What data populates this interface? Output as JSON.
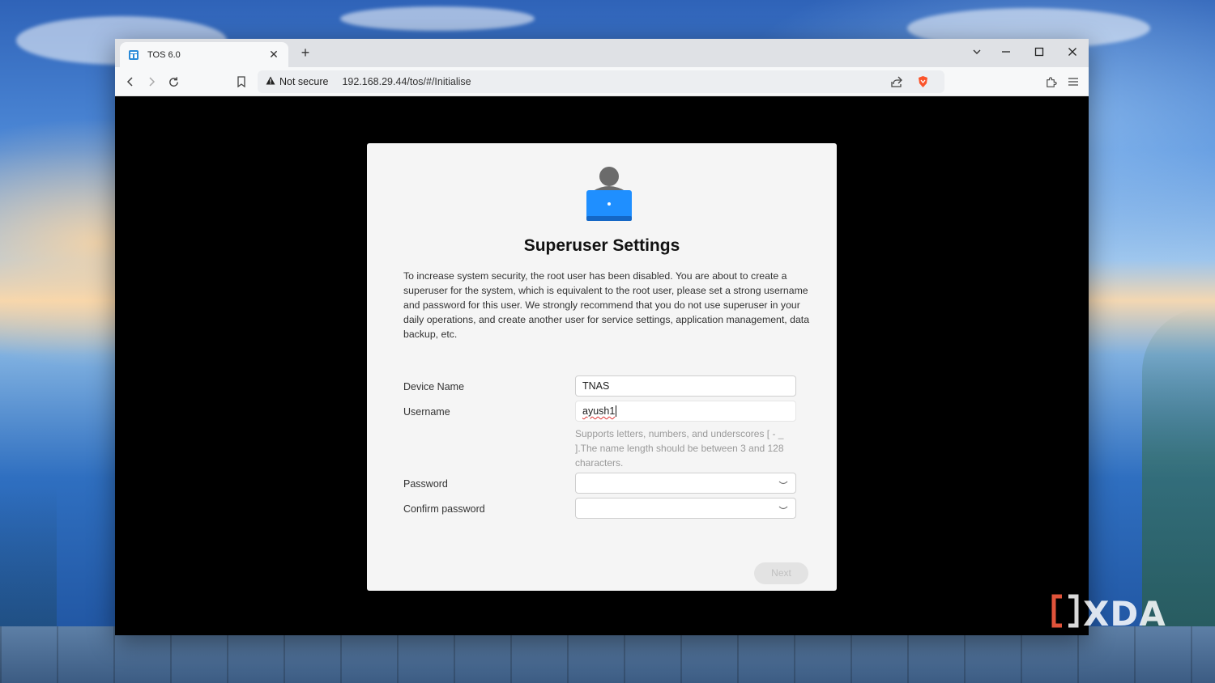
{
  "browser": {
    "tab": {
      "title": "TOS 6.0"
    },
    "address_bar": {
      "security_label": "Not secure",
      "url": "192.168.29.44/tos/#/Initialise"
    }
  },
  "dialog": {
    "title": "Superuser Settings",
    "description": "To increase system security, the root user has been disabled. You are about to create a superuser for the system, which is equivalent to the root user, please set a strong username and password for this user. We strongly recommend that you do not use superuser in your daily operations, and create another user for service settings, application management, data backup, etc.",
    "fields": {
      "device_name": {
        "label": "Device Name",
        "value": "TNAS"
      },
      "username": {
        "label": "Username",
        "value": "ayush1",
        "hint": "Supports letters, numbers, and underscores [ - _ ].The name length should be between 3 and 128 characters."
      },
      "password": {
        "label": "Password",
        "value": ""
      },
      "confirm_password": {
        "label": "Confirm password",
        "value": ""
      }
    },
    "next_label": "Next"
  },
  "watermark": {
    "text": "XDA"
  },
  "colors": {
    "accent_blue": "#1f8fff",
    "tab_icon": "#2a8ad8",
    "brave_orange": "#fb542b"
  }
}
